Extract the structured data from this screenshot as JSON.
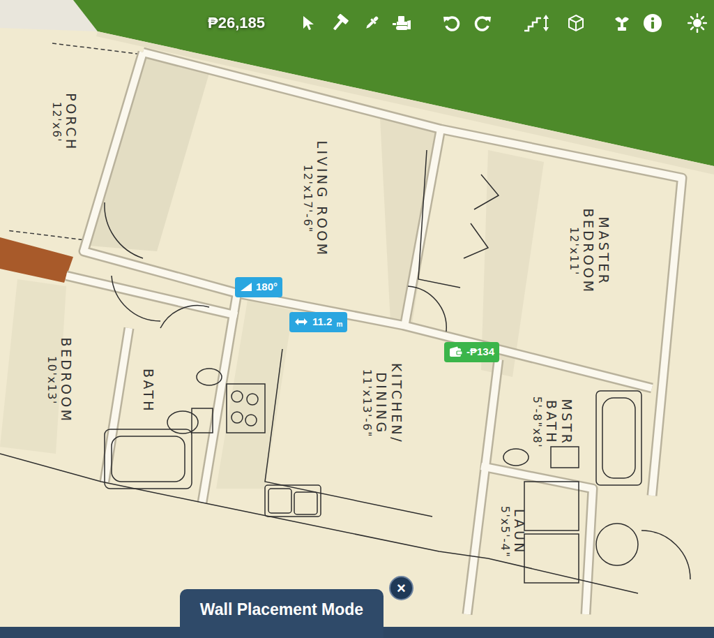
{
  "toolbar": {
    "money": "₱26,185"
  },
  "rooms": [
    {
      "lines": [
        "PORCH"
      ],
      "size": "12'x6'"
    },
    {
      "lines": [
        "LIVING ROOM"
      ],
      "size": "12'x17'-6\""
    },
    {
      "lines": [
        "MASTER",
        "BEDROOM"
      ],
      "size": "12'x11'"
    },
    {
      "lines": [
        "BEDROOM"
      ],
      "size": "10'x13'"
    },
    {
      "lines": [
        "BATH"
      ],
      "size": ""
    },
    {
      "lines": [
        "KITCHEN/",
        "DINING"
      ],
      "size": "11'x13'-6\""
    },
    {
      "lines": [
        "MSTR",
        "BATH"
      ],
      "size": "5'-8\"x8'"
    },
    {
      "lines": [
        "LAUN"
      ],
      "size": "5'x5'-4\""
    }
  ],
  "wall_tooltips": {
    "angle": "180°",
    "length": "11.2",
    "unit": "m",
    "cost": "-₱134"
  },
  "mode_panel": {
    "label": "Wall Placement Mode",
    "close": "×"
  }
}
